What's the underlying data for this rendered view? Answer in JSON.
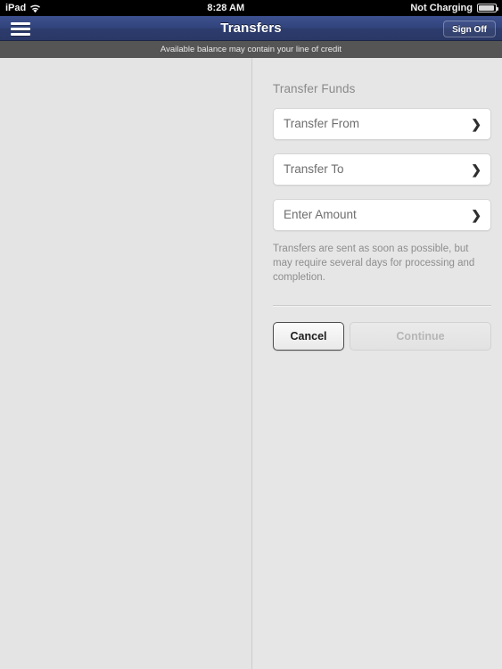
{
  "statusbar": {
    "device": "iPad",
    "wifi_icon": "wifi-icon",
    "time": "8:28 AM",
    "battery_text": "Not Charging",
    "battery_icon": "battery-icon"
  },
  "navbar": {
    "menu_icon": "hamburger-menu-icon",
    "title": "Transfers",
    "signoff_label": "Sign Off",
    "accent_color": "#2c3c6d"
  },
  "subheader": {
    "notice": "Available balance may contain your line of credit",
    "background_color": "#555555"
  },
  "form": {
    "section_title": "Transfer Funds",
    "rows": [
      {
        "label": "Transfer From",
        "chevron": "❯"
      },
      {
        "label": "Transfer To",
        "chevron": "❯"
      },
      {
        "label": "Enter Amount",
        "chevron": "❯"
      }
    ],
    "note": "Transfers are sent as soon as possible, but may require several days for processing and completion.",
    "cancel_label": "Cancel",
    "continue_label": "Continue"
  }
}
